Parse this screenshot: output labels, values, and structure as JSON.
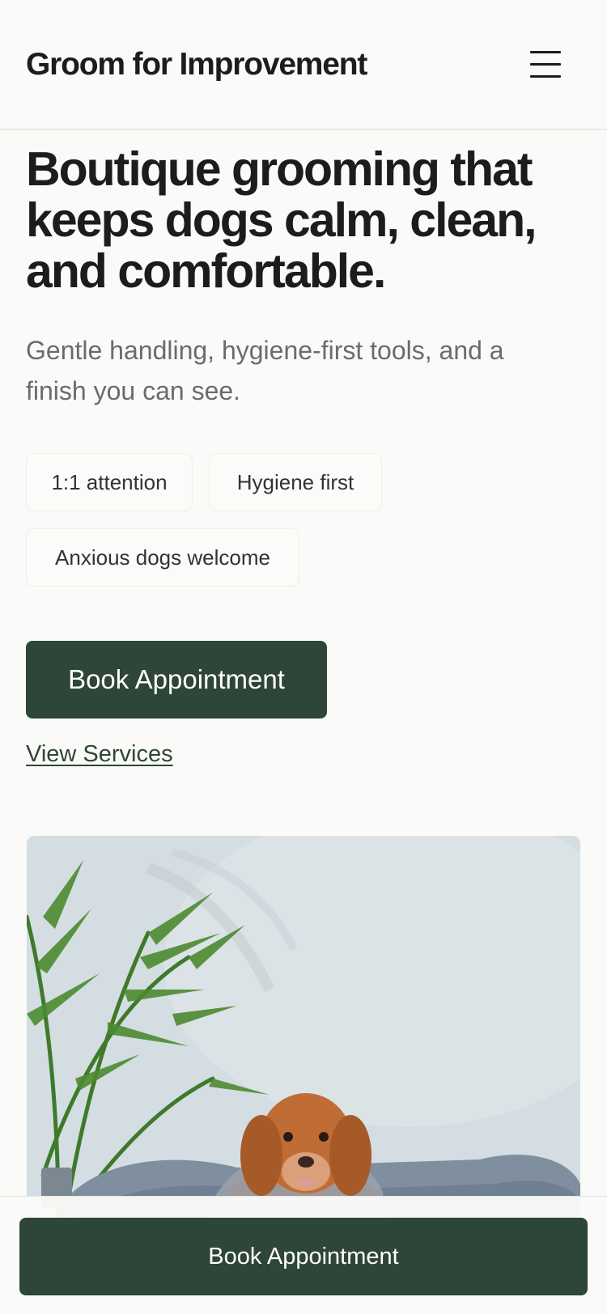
{
  "header": {
    "brand": "Groom for Improvement",
    "menu_icon": "hamburger-menu-icon"
  },
  "hero": {
    "title": "Boutique grooming that keeps dogs calm, clean, and comfortable.",
    "subtitle": "Gentle handling, hygiene-first tools, and a finish you can see.",
    "chips": [
      "1:1 attention",
      "Hygiene first",
      "Anxious dogs welcome"
    ],
    "primary_cta": "Book Appointment",
    "secondary_link": "View Services"
  },
  "sticky": {
    "cta": "Book Appointment"
  },
  "colors": {
    "accent": "#2e4539",
    "background": "#fafaf8",
    "text": "#1c1c1c",
    "muted": "#6b6b6b"
  }
}
